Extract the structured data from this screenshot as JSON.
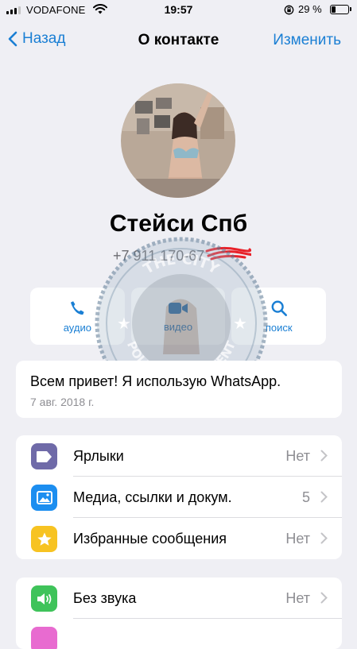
{
  "status_bar": {
    "carrier": "VODAFONE",
    "time": "19:57",
    "battery_percent": "29 %",
    "battery_level": 0.29
  },
  "nav": {
    "back_label": "Назад",
    "title": "О контакте",
    "edit_label": "Изменить"
  },
  "profile": {
    "name": "Стейси Спб",
    "phone": "+7 911 170-67"
  },
  "actions": [
    {
      "label": "аудио",
      "icon": "phone-icon"
    },
    {
      "label": "видео",
      "icon": "video-icon"
    },
    {
      "label": "поиск",
      "icon": "search-icon"
    }
  ],
  "about": {
    "text": "Всем привет! Я использую WhatsApp.",
    "date": "7 авг. 2018 г."
  },
  "list1": [
    {
      "label": "Ярлыки",
      "value": "Нет",
      "icon": "label-tag-icon",
      "color": "#6f6aa8"
    },
    {
      "label": "Медиа, ссылки и докум.",
      "value": "5",
      "icon": "media-image-icon",
      "color": "#1c8ef0"
    },
    {
      "label": "Избранные сообщения",
      "value": "Нет",
      "icon": "star-icon",
      "color": "#f7c322"
    }
  ],
  "list2": [
    {
      "label": "Без звука",
      "value": "Нет",
      "icon": "speaker-icon",
      "color": "#3fc35a"
    }
  ],
  "watermark": {
    "text_top": "THE CITY",
    "text_bottom": "POLICE DEPARTMENT"
  },
  "colors": {
    "accent": "#1a7fd4",
    "background": "#efeff4",
    "scribble": "#e8222a"
  }
}
